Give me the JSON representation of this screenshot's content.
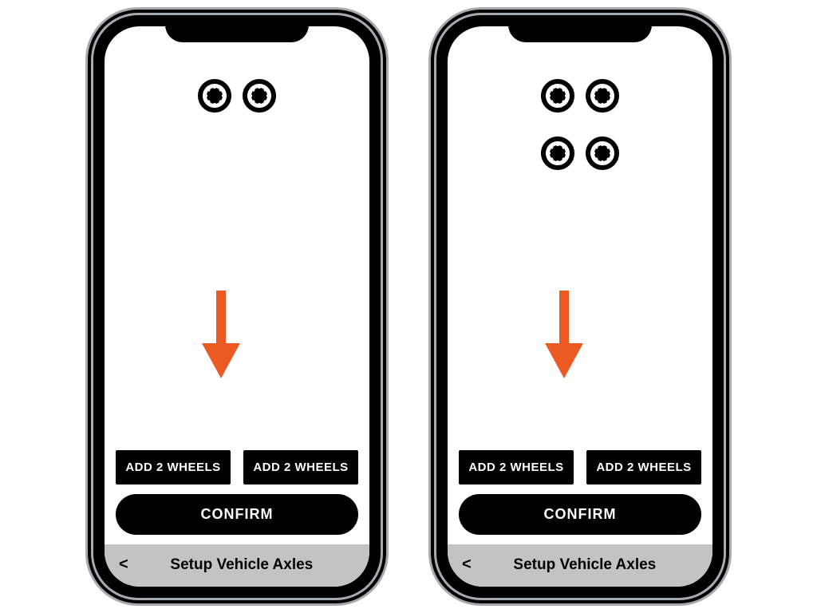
{
  "arrow_color": "#ec5a24",
  "phones": [
    {
      "axle_rows": 1,
      "buttons": {
        "add_left": "ADD 2 WHEELS",
        "add_right": "ADD 2 WHEELS",
        "confirm": "CONFIRM"
      },
      "footer": {
        "back": "<",
        "title": "Setup Vehicle Axles"
      }
    },
    {
      "axle_rows": 2,
      "buttons": {
        "add_left": "ADD 2 WHEELS",
        "add_right": "ADD 2 WHEELS",
        "confirm": "CONFIRM"
      },
      "footer": {
        "back": "<",
        "title": "Setup Vehicle Axles"
      }
    }
  ]
}
